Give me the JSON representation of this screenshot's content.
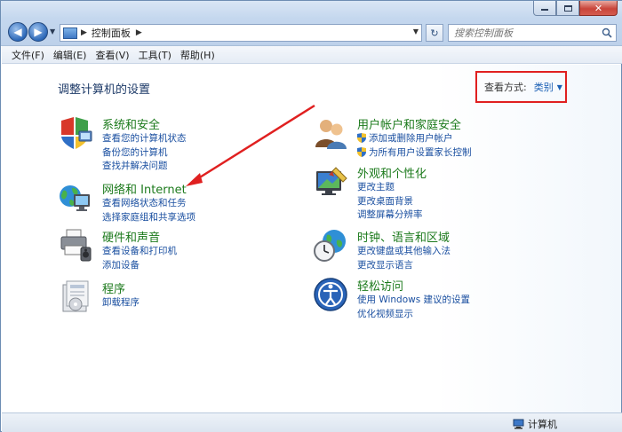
{
  "address": {
    "crumb": "控制面板"
  },
  "search": {
    "placeholder": "搜索控制面板"
  },
  "menu": [
    "文件(F)",
    "编辑(E)",
    "查看(V)",
    "工具(T)",
    "帮助(H)"
  ],
  "page": {
    "title": "调整计算机的设置"
  },
  "viewby": {
    "label": "查看方式:",
    "value": "类别"
  },
  "categories": [
    {
      "icon": "system-security-icon",
      "title": "系统和安全",
      "links": [
        "查看您的计算机状态",
        "备份您的计算机",
        "查找并解决问题"
      ]
    },
    {
      "icon": "network-internet-icon",
      "title": "网络和 Internet",
      "links": [
        "查看网络状态和任务",
        "选择家庭组和共享选项"
      ]
    },
    {
      "icon": "hardware-sound-icon",
      "title": "硬件和声音",
      "links": [
        "查看设备和打印机",
        "添加设备"
      ]
    },
    {
      "icon": "programs-icon",
      "title": "程序",
      "links": [
        "卸载程序"
      ]
    },
    {
      "icon": "user-accounts-icon",
      "title": "用户帐户和家庭安全",
      "links": [
        "添加或删除用户帐户",
        "为所有用户设置家长控制"
      ]
    },
    {
      "icon": "appearance-icon",
      "title": "外观和个性化",
      "links": [
        "更改主题",
        "更改桌面背景",
        "调整屏幕分辨率"
      ]
    },
    {
      "icon": "clock-language-region-icon",
      "title": "时钟、语言和区域",
      "links": [
        "更改键盘或其他输入法",
        "更改显示语言"
      ]
    },
    {
      "icon": "ease-of-access-icon",
      "title": "轻松访问",
      "links": [
        "使用 Windows 建议的设置",
        "优化视频显示"
      ]
    }
  ],
  "status": {
    "computer": "计算机"
  },
  "colors": {
    "category_title": "#1c7a1c",
    "link": "#1a4fa0",
    "highlight": "#e02020"
  }
}
